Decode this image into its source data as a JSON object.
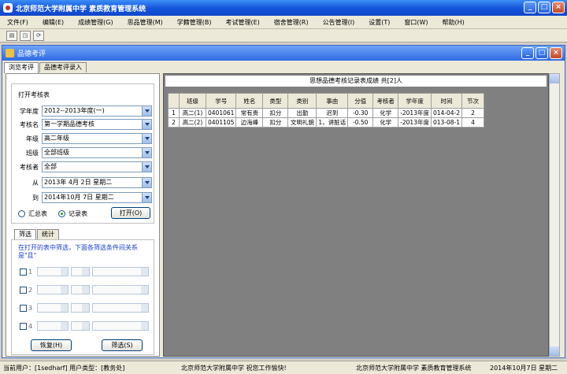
{
  "window": {
    "title": "北京师范大学附属中学  素质教育管理系统"
  },
  "menu": [
    "文件(F)",
    "编辑(E)",
    "成绩管理(G)",
    "思品管理(M)",
    "学籍管理(B)",
    "考试管理(E)",
    "宿舍管理(R)",
    "公告管理(I)",
    "设置(T)",
    "窗口(W)",
    "帮助(H)"
  ],
  "child": {
    "title": "品德考评",
    "tabs": [
      "浏览考评",
      "品德考评录入"
    ]
  },
  "form": {
    "group_title": "打开考核表",
    "labels": {
      "year": "学年度",
      "exam": "考核名",
      "grade": "年级",
      "class": "班级",
      "examiner": "考核者",
      "from": "从",
      "to": "到"
    },
    "values": {
      "year": "2012--2013年度(一)",
      "exam": "第一学期品德考核",
      "grade": "高二年级",
      "class": "全部班级",
      "examiner": "全部",
      "from": "2013年 4月 2日 星期二",
      "to": "2014年10月 7日 星期二"
    },
    "radio_summary": "汇总表",
    "radio_record": "记录表",
    "open_button": "打开(O)"
  },
  "filter": {
    "tabs": [
      "筛选",
      "统计"
    ],
    "hint": "在打开的表中筛选，下面各筛选条件间关系是\"且\"",
    "rows": [
      "1",
      "2",
      "3",
      "4"
    ],
    "restore_button": "恢复(H)",
    "filter_button": "筛选(S)"
  },
  "report": {
    "title": "思想品德考核记录表成绩   共[2]人",
    "headers": [
      "",
      "班级",
      "学号",
      "姓名",
      "类型",
      "类别",
      "事由",
      "分值",
      "考核者",
      "学年度",
      "时间",
      "节次"
    ],
    "rows": [
      [
        "1",
        "高二(1)",
        "0401061",
        "常有贵",
        "扣分",
        "出勤",
        "迟到",
        "-0.30",
        "化学",
        "-2013年度",
        "014-04-2",
        "2"
      ],
      [
        "2",
        "高二(2)",
        "0401105",
        "边海峰",
        "扣分",
        "文明礼貌",
        "1，讲脏话",
        "-0.50",
        "化学",
        "-2013年度",
        "013-08-1",
        "4"
      ]
    ]
  },
  "status": {
    "user": "当前用户：[1sedharf] 用户类型：[教务处]",
    "greeting": "北京师范大学附属中学  祝您工作愉快!",
    "system": "北京师范大学附属中学  素质教育管理系统",
    "date": "2014年10月7日  星期二"
  }
}
